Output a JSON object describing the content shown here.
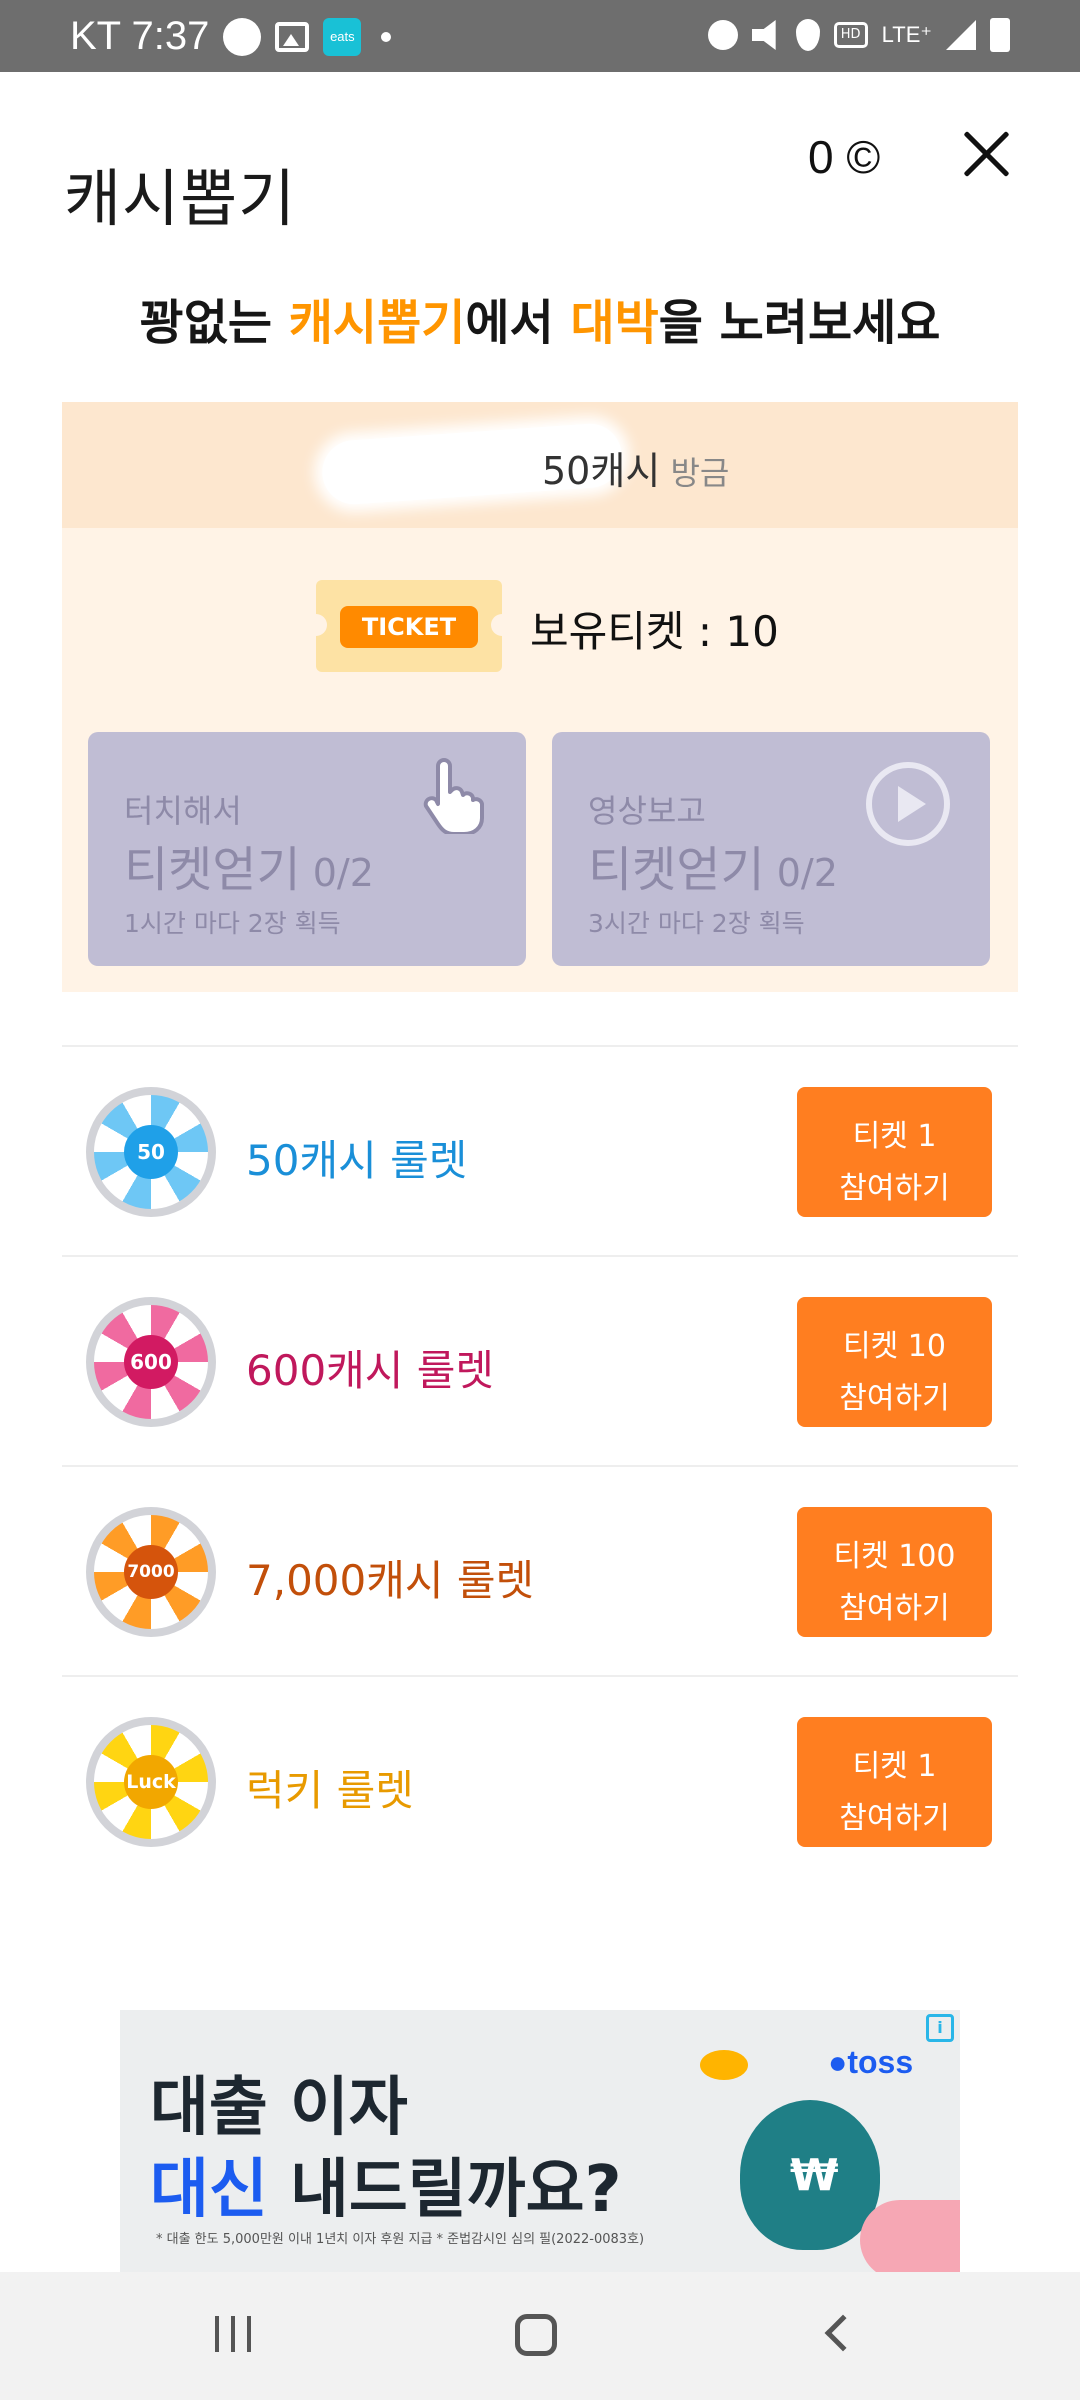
{
  "status_bar": {
    "carrier_time": "KT 7:37",
    "eats_badge": "eats",
    "hd_label": "HD",
    "network_label": "LTE⁺"
  },
  "header": {
    "title": "캐시뽑기",
    "cash_partial": "0 ©"
  },
  "headline": {
    "part1": "꽝없는 ",
    "part2": "캐시뽑기",
    "part3": "에서 ",
    "part4": "대박",
    "part5": "을 노려보세요",
    "accent_color": "#ff9500"
  },
  "info": {
    "recent_partial": "50캐시",
    "recent_suffix": " 방금",
    "ticket_badge": "TICKET",
    "ticket_count_label": "보유티켓 : 10",
    "earn_cards": [
      {
        "line1": "터치해서",
        "line2": "티켓얻기",
        "fraction": " 0/2",
        "line3": "1시간 마다 2장 획득",
        "icon": "hand-pointer-icon"
      },
      {
        "line1": "영상보고",
        "line2": "티켓얻기",
        "fraction": " 0/2",
        "line3": "3시간 마다 2장 획득",
        "icon": "play-circle-icon"
      }
    ]
  },
  "roulettes": [
    {
      "badge": "50",
      "name": "50캐시 룰렛",
      "name_color": "#1a8fd8",
      "ticket_label": "티켓 1",
      "join_label": "참여하기"
    },
    {
      "badge": "600",
      "name": "600캐시 룰렛",
      "name_color": "#c0185c",
      "ticket_label": "티켓 10",
      "join_label": "참여하기"
    },
    {
      "badge": "7000",
      "name": "7,000캐시 룰렛",
      "name_color": "#c24f0a",
      "ticket_label": "티켓 100",
      "join_label": "참여하기"
    },
    {
      "badge": "Luck",
      "name": "럭키 룰렛",
      "name_color": "#e89a00",
      "ticket_label": "티켓 1",
      "join_label": "참여하기"
    }
  ],
  "ad": {
    "line1": "대출 이자",
    "line2_blue": "대신",
    "line2_rest": " 내드릴까요?",
    "brand": "●toss",
    "disclaimer": "* 대출 한도 5,000만원 이내 1년치 이자 후원 지급 * 준법감시인 심의 필(2022-0083호)"
  },
  "colors": {
    "button_orange": "#ff7e20",
    "info_bg": "#fff3e6"
  }
}
